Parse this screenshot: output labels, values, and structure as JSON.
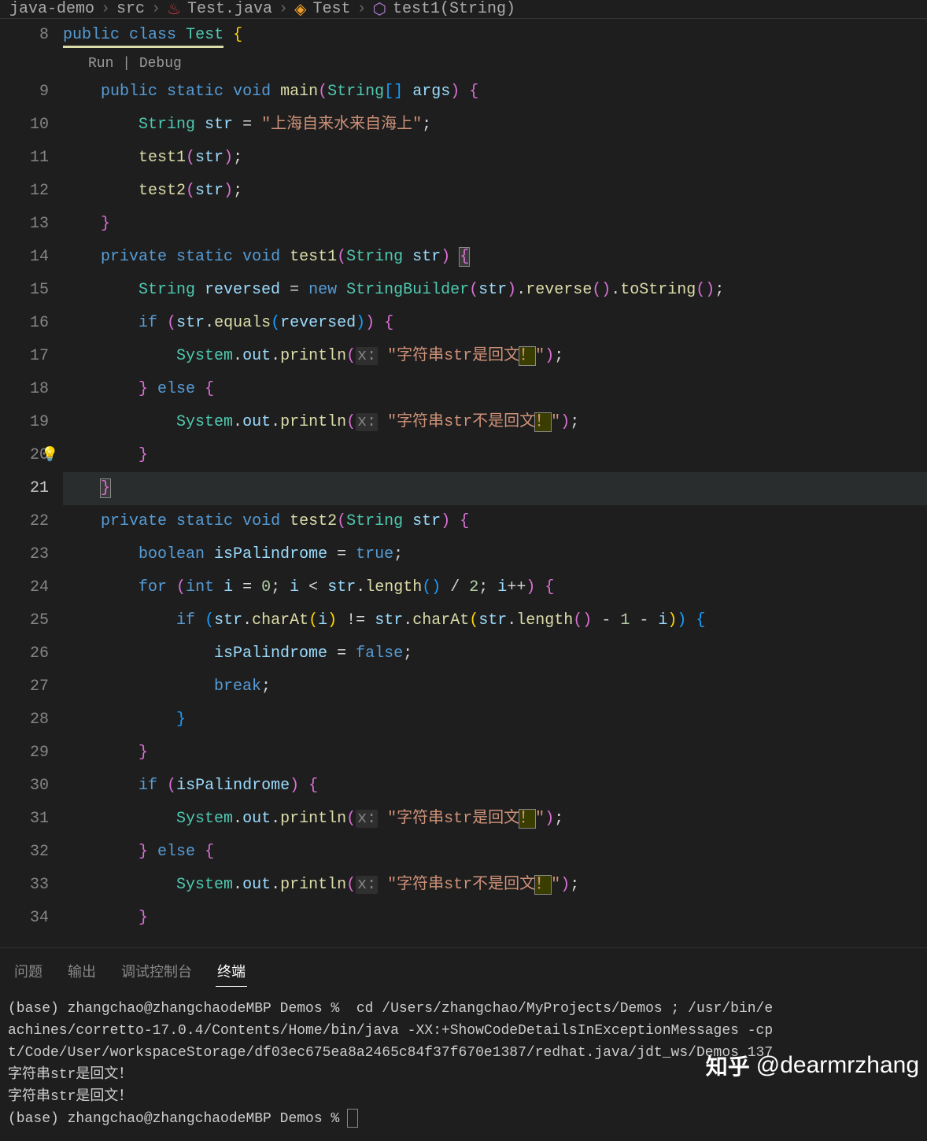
{
  "breadcrumb": {
    "seg1": "java-demo",
    "seg2": "src",
    "seg3": "Test.java",
    "seg4": "Test",
    "seg5": "test1(String)"
  },
  "codelens": {
    "run": "Run",
    "debug": "Debug"
  },
  "gutter": {
    "start": 8,
    "end": 34,
    "active": 21
  },
  "code": {
    "l8": {
      "public": "public",
      "class": "class",
      "name": "Test",
      "brace": "{"
    },
    "l9": {
      "public": "public",
      "static": "static",
      "void": "void",
      "main": "main",
      "String": "String",
      "args": "args"
    },
    "l10": {
      "String": "String",
      "str": "str",
      "eq": "=",
      "val": "\"上海自来水来自海上\""
    },
    "l11": {
      "fn": "test1",
      "arg": "str"
    },
    "l12": {
      "fn": "test2",
      "arg": "str"
    },
    "l14": {
      "private": "private",
      "static": "static",
      "void": "void",
      "fn": "test1",
      "String": "String",
      "param": "str"
    },
    "l15": {
      "String": "String",
      "var": "reversed",
      "new": "new",
      "SB": "StringBuilder",
      "arg": "str",
      "rev": "reverse",
      "ts": "toString"
    },
    "l16": {
      "if": "if",
      "str": "str",
      "equals": "equals",
      "rev": "reversed"
    },
    "l17": {
      "System": "System",
      "out": "out",
      "println": "println",
      "hint": "x:",
      "msg": "\"字符串str是回文！\""
    },
    "l18": {
      "else": "else"
    },
    "l19": {
      "System": "System",
      "out": "out",
      "println": "println",
      "hint": "x:",
      "msg": "\"字符串str不是回文！\""
    },
    "l22": {
      "private": "private",
      "static": "static",
      "void": "void",
      "fn": "test2",
      "String": "String",
      "param": "str"
    },
    "l23": {
      "boolean": "boolean",
      "var": "isPalindrome",
      "true": "true"
    },
    "l24": {
      "for": "for",
      "int": "int",
      "i": "i",
      "zero": "0",
      "str": "str",
      "length": "length",
      "two": "2",
      "ipp": "i++"
    },
    "l25": {
      "if": "if",
      "str": "str",
      "charAt": "charAt",
      "i": "i",
      "length": "length",
      "one": "1"
    },
    "l26": {
      "var": "isPalindrome",
      "false": "false"
    },
    "l27": {
      "break": "break"
    },
    "l30": {
      "if": "if",
      "var": "isPalindrome"
    },
    "l31": {
      "System": "System",
      "out": "out",
      "println": "println",
      "hint": "x:",
      "msg": "\"字符串str是回文！\""
    },
    "l32": {
      "else": "else"
    },
    "l33": {
      "System": "System",
      "out": "out",
      "println": "println",
      "hint": "x:",
      "msg": "\"字符串str不是回文！\""
    }
  },
  "panel": {
    "tabs": {
      "problems": "问题",
      "output": "输出",
      "debug": "调试控制台",
      "terminal": "终端"
    },
    "terminal_lines": [
      "(base) zhangchao@zhangchaodeMBP Demos %  cd /Users/zhangchao/MyProjects/Demos ; /usr/bin/e",
      "achines/corretto-17.0.4/Contents/Home/bin/java -XX:+ShowCodeDetailsInExceptionMessages -cp",
      "t/Code/User/workspaceStorage/df03ec675ea8a2465c84f37f670e1387/redhat.java/jdt_ws/Demos_137",
      "字符串str是回文！",
      "字符串str是回文！",
      "(base) zhangchao@zhangchaodeMBP Demos % "
    ]
  },
  "watermark": {
    "logo": "知乎",
    "handle": "@dearmrzhang"
  }
}
